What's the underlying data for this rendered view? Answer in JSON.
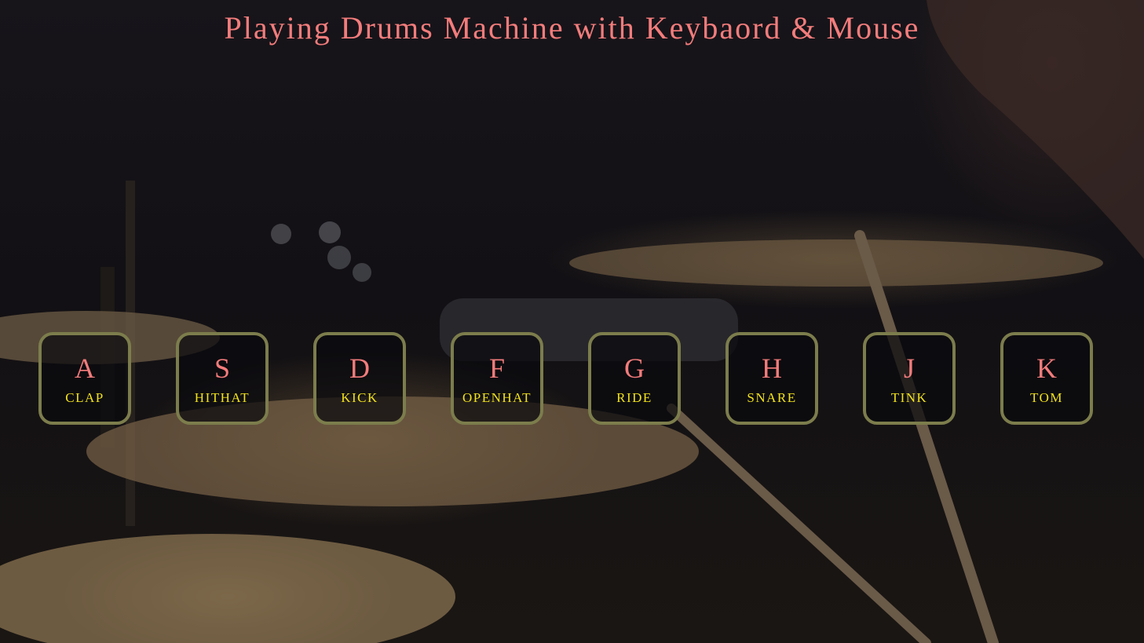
{
  "page": {
    "title": "Playing Drums Machine with Keybaord & Mouse"
  },
  "keys": [
    {
      "key": "A",
      "sound": "CLAP"
    },
    {
      "key": "S",
      "sound": "HITHAT"
    },
    {
      "key": "D",
      "sound": "KICK"
    },
    {
      "key": "F",
      "sound": "OPENHAT"
    },
    {
      "key": "G",
      "sound": "RIDE"
    },
    {
      "key": "H",
      "sound": "SNARE"
    },
    {
      "key": "J",
      "sound": "TINK"
    },
    {
      "key": "K",
      "sound": "TOM"
    }
  ],
  "colors": {
    "title": "#f47c7c",
    "key_letter": "#f47c7c",
    "sound_label": "#f2e21c",
    "key_border": "#7c7d4c"
  }
}
